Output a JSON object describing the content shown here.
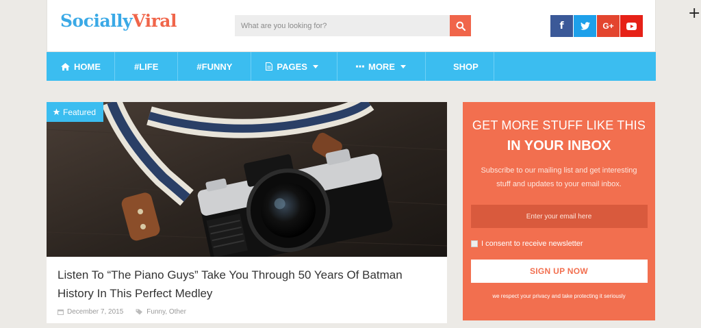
{
  "header": {
    "logo_part1": "Socially",
    "logo_part2": "Viral",
    "search_placeholder": "What are you looking for?",
    "socials": [
      {
        "icon": "facebook-icon",
        "glyph": "f"
      },
      {
        "icon": "twitter-icon",
        "glyph": "t"
      },
      {
        "icon": "google-plus-icon",
        "glyph": "G+"
      },
      {
        "icon": "youtube-icon",
        "glyph": "▶"
      }
    ]
  },
  "nav": {
    "items": [
      {
        "label": "HOME",
        "icon": "home-icon"
      },
      {
        "label": "#LIFE"
      },
      {
        "label": "#FUNNY"
      },
      {
        "label": "PAGES",
        "icon": "document-icon",
        "dropdown": true
      },
      {
        "label": "MORE",
        "icon": "ellipsis-icon",
        "dropdown": true
      },
      {
        "label": "SHOP"
      }
    ]
  },
  "featured": {
    "badge": "Featured",
    "title": "Listen To “The Piano Guys” Take You Through 50 Years Of Batman History In This Perfect Medley",
    "date": "December 7, 2015",
    "categories": "Funny, Other"
  },
  "newsletter": {
    "title1": "GET MORE STUFF LIKE THIS",
    "title2": "IN YOUR INBOX",
    "description": "Subscribe to our mailing list and get interesting stuff and updates to your email inbox.",
    "email_placeholder": "Enter your email here",
    "consent": "I consent to receive newsletter",
    "button": "SIGN UP NOW",
    "privacy": "we respect your privacy and take protecting it seriously"
  },
  "colors": {
    "accent_blue": "#3bbdf0",
    "accent_orange": "#f26f4f",
    "background": "#eceae6"
  }
}
